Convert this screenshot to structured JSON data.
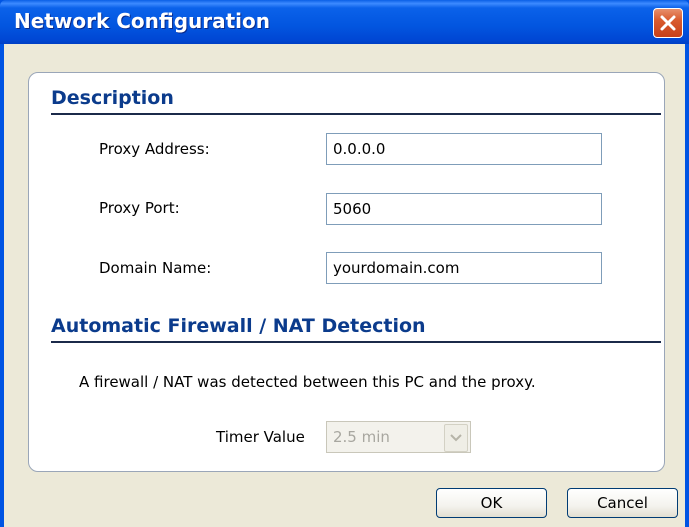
{
  "window": {
    "title": "Network Configuration"
  },
  "description": {
    "heading": "Description",
    "proxy_address": {
      "label": "Proxy Address:",
      "value": "0.0.0.0"
    },
    "proxy_port": {
      "label": "Proxy Port:",
      "value": "5060"
    },
    "domain_name": {
      "label": "Domain Name:",
      "value": "yourdomain.com"
    }
  },
  "firewall": {
    "heading": "Automatic Firewall / NAT Detection",
    "status": "A firewall / NAT was detected between this PC and the proxy.",
    "timer": {
      "label": "Timer Value",
      "selected": "2.5 min",
      "disabled": true
    }
  },
  "buttons": {
    "ok": "OK",
    "cancel": "Cancel"
  },
  "colors": {
    "title_bar": "#0054e3",
    "section_heading": "#0b3b8c",
    "close_button": "#d95b2e"
  },
  "icons": {
    "close": "close-icon",
    "dropdown": "chevron-down-icon"
  }
}
